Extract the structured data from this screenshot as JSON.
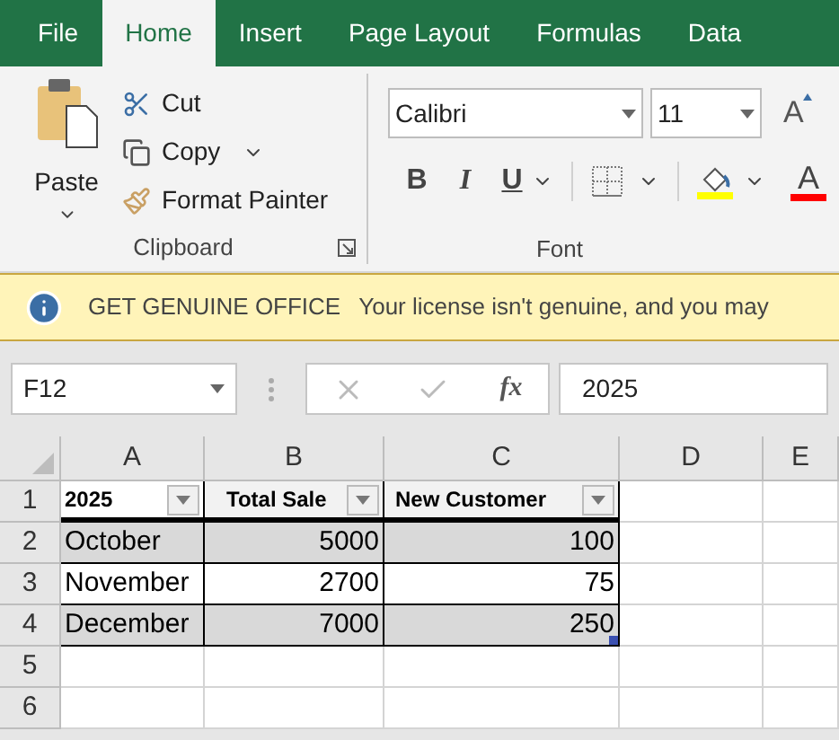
{
  "tabs": [
    {
      "label": "File",
      "selected": false
    },
    {
      "label": "Home",
      "selected": true
    },
    {
      "label": "Insert",
      "selected": false
    },
    {
      "label": "Page Layout",
      "selected": false
    },
    {
      "label": "Formulas",
      "selected": false
    },
    {
      "label": "Data",
      "selected": false
    }
  ],
  "ribbon": {
    "clipboard": {
      "paste": "Paste",
      "cut": "Cut",
      "copy": "Copy",
      "format_painter": "Format Painter",
      "label": "Clipboard"
    },
    "font": {
      "name": "Calibri",
      "size": "11",
      "grow": "A",
      "bold": "B",
      "italic": "I",
      "underline": "U",
      "font_color": "A",
      "label": "Font"
    }
  },
  "banner": {
    "title": "GET GENUINE OFFICE",
    "message": "Your license isn't genuine, and you may"
  },
  "formula_bar": {
    "name_box": "F12",
    "fx": "fx",
    "value": "2025"
  },
  "sheet": {
    "columns": [
      "A",
      "B",
      "C",
      "D",
      "E"
    ],
    "rows": [
      {
        "number": "1",
        "kind": "header",
        "cells": [
          {
            "text": "2025",
            "kind": "text"
          },
          {
            "text": "Total Sale",
            "kind": "text"
          },
          {
            "text": "New Customer",
            "kind": "text"
          }
        ]
      },
      {
        "number": "2",
        "kind": "data",
        "banded": true,
        "cells": [
          {
            "text": "October",
            "kind": "text"
          },
          {
            "text": "5000",
            "kind": "number"
          },
          {
            "text": "100",
            "kind": "number"
          }
        ]
      },
      {
        "number": "3",
        "kind": "data",
        "banded": false,
        "cells": [
          {
            "text": "November",
            "kind": "text"
          },
          {
            "text": "2700",
            "kind": "number"
          },
          {
            "text": "75",
            "kind": "number"
          }
        ]
      },
      {
        "number": "4",
        "kind": "data",
        "banded": true,
        "cells": [
          {
            "text": "December",
            "kind": "text"
          },
          {
            "text": "7000",
            "kind": "number"
          },
          {
            "text": "250",
            "kind": "number",
            "handle": true
          }
        ]
      },
      {
        "number": "5",
        "kind": "empty"
      },
      {
        "number": "6",
        "kind": "empty"
      }
    ]
  }
}
